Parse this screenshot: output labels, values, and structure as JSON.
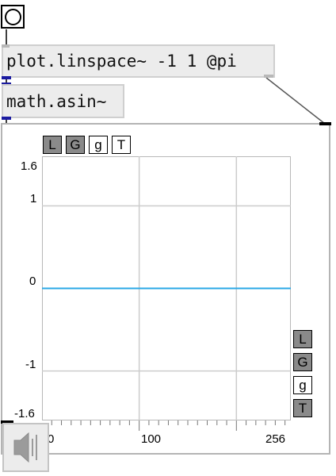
{
  "objects": {
    "linspace_text": "plot.linspace~ -1 1 @pi",
    "asin_text": "math.asin~"
  },
  "plot": {
    "y_ticks": [
      "1.6",
      "1",
      "0",
      "-1",
      "-1.6"
    ],
    "x_ticks": [
      "0",
      "100",
      "256"
    ],
    "top_buttons": [
      {
        "label": "L",
        "state": "on"
      },
      {
        "label": "G",
        "state": "on"
      },
      {
        "label": "g",
        "state": "off"
      },
      {
        "label": "T",
        "state": "off"
      }
    ],
    "side_buttons": [
      {
        "label": "L",
        "state": "on"
      },
      {
        "label": "G",
        "state": "on"
      },
      {
        "label": "g",
        "state": "off"
      },
      {
        "label": "T",
        "state": "on"
      }
    ],
    "series_color": "#2aa8e6",
    "grid_color": "#cccccc"
  },
  "chart_data": {
    "type": "line",
    "xlim": [
      0,
      256
    ],
    "ylim": [
      -1.6,
      1.6
    ],
    "x": [
      0,
      256
    ],
    "series": [
      {
        "values": [
          0,
          0
        ]
      }
    ],
    "grid": true
  }
}
